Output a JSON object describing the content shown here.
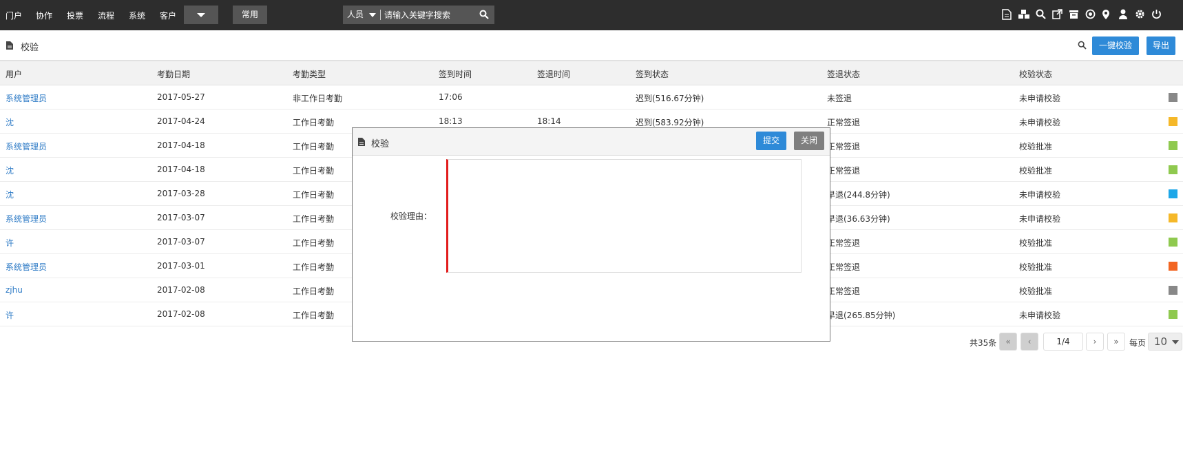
{
  "topnav": {
    "items": [
      {
        "label": "门户"
      },
      {
        "label": "协作"
      },
      {
        "label": "投票"
      },
      {
        "label": "流程"
      },
      {
        "label": "系统"
      },
      {
        "label": "客户"
      }
    ],
    "common_label": "常用",
    "search": {
      "scope": "人员",
      "placeholder": "请输入关键字搜索"
    },
    "right_icons": [
      "document-icon",
      "cubes-icon",
      "search-icon",
      "external-link-icon",
      "archive-icon",
      "record-icon",
      "map-marker-icon",
      "user-icon",
      "gear-icon",
      "power-icon"
    ]
  },
  "header": {
    "title": "校验",
    "one_click_label": "一键校验",
    "export_label": "导出"
  },
  "table": {
    "columns": [
      "用户",
      "考勤日期",
      "考勤类型",
      "签到时间",
      "签退时间",
      "签到状态",
      "签退状态",
      "校验状态"
    ],
    "rows": [
      {
        "user": "系统管理员",
        "date": "2017-05-27",
        "type": "非工作日考勤",
        "in": "17:06",
        "out": "",
        "in_status": "迟到(516.67分钟)",
        "out_status": "未签退",
        "verify": "未申请校验",
        "color": "#888888"
      },
      {
        "user": "沈",
        "date": "2017-04-24",
        "type": "工作日考勤",
        "in": "18:13",
        "out": "18:14",
        "in_status": "迟到(583.92分钟)",
        "out_status": "正常签退",
        "verify": "未申请校验",
        "color": "#f5b829"
      },
      {
        "user": "系统管理员",
        "date": "2017-04-18",
        "type": "工作日考勤",
        "in": "",
        "out": "",
        "in_status": "",
        "out_status": "正常签退",
        "verify": "校验批准",
        "color": "#8fc94f"
      },
      {
        "user": "沈",
        "date": "2017-04-18",
        "type": "工作日考勤",
        "in": "",
        "out": "",
        "in_status": "",
        "out_status": "正常签退",
        "verify": "校验批准",
        "color": "#8fc94f"
      },
      {
        "user": "沈",
        "date": "2017-03-28",
        "type": "工作日考勤",
        "in": "",
        "out": "",
        "in_status": "",
        "out_status": "早退(244.8分钟)",
        "verify": "未申请校验",
        "color": "#1ea7e8"
      },
      {
        "user": "系统管理员",
        "date": "2017-03-07",
        "type": "工作日考勤",
        "in": "",
        "out": "",
        "in_status": "",
        "out_status": "早退(36.63分钟)",
        "verify": "未申请校验",
        "color": "#f5b829"
      },
      {
        "user": "许",
        "date": "2017-03-07",
        "type": "工作日考勤",
        "in": "",
        "out": "",
        "in_status": "",
        "out_status": "正常签退",
        "verify": "校验批准",
        "color": "#8fc94f"
      },
      {
        "user": "系统管理员",
        "date": "2017-03-01",
        "type": "工作日考勤",
        "in": "",
        "out": "",
        "in_status": "",
        "out_status": "正常签退",
        "verify": "校验批准",
        "color": "#f26522"
      },
      {
        "user": "zjhu",
        "date": "2017-02-08",
        "type": "工作日考勤",
        "in": "",
        "out": "",
        "in_status": "",
        "out_status": "正常签退",
        "verify": "校验批准",
        "color": "#888888"
      },
      {
        "user": "许",
        "date": "2017-02-08",
        "type": "工作日考勤",
        "in": "",
        "out": "",
        "in_status": "",
        "out_status": "早退(265.85分钟)",
        "verify": "未申请校验",
        "color": "#8fc94f"
      }
    ]
  },
  "pagination": {
    "total": "共35条",
    "first": "«",
    "prev": "‹",
    "current": "1/4",
    "next": "›",
    "last": "»",
    "per_page_label": "每页",
    "page_size": "10"
  },
  "modal": {
    "title": "校验",
    "submit_label": "提交",
    "close_label": "关闭",
    "reason_label": "校验理由："
  },
  "colors": {
    "accent": "#2e8ad8",
    "nav_bg": "#2d2d2d",
    "link": "#2e7bc6",
    "required": "#e21c1c"
  }
}
